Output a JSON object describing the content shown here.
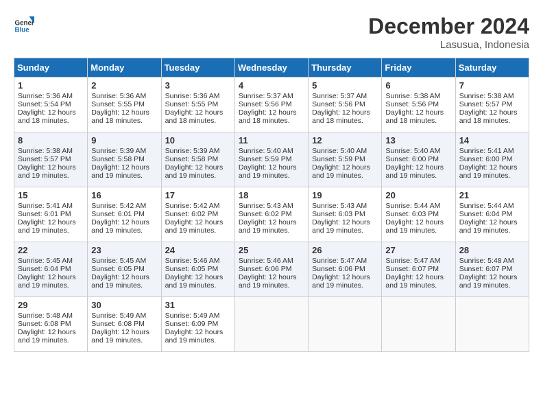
{
  "header": {
    "logo_general": "General",
    "logo_blue": "Blue",
    "month": "December 2024",
    "location": "Lasusua, Indonesia"
  },
  "days_of_week": [
    "Sunday",
    "Monday",
    "Tuesday",
    "Wednesday",
    "Thursday",
    "Friday",
    "Saturday"
  ],
  "weeks": [
    [
      {
        "day": 1,
        "sunrise": "5:36 AM",
        "sunset": "5:54 PM",
        "daylight": "12 hours and 18 minutes."
      },
      {
        "day": 2,
        "sunrise": "5:36 AM",
        "sunset": "5:55 PM",
        "daylight": "12 hours and 18 minutes."
      },
      {
        "day": 3,
        "sunrise": "5:36 AM",
        "sunset": "5:55 PM",
        "daylight": "12 hours and 18 minutes."
      },
      {
        "day": 4,
        "sunrise": "5:37 AM",
        "sunset": "5:56 PM",
        "daylight": "12 hours and 18 minutes."
      },
      {
        "day": 5,
        "sunrise": "5:37 AM",
        "sunset": "5:56 PM",
        "daylight": "12 hours and 18 minutes."
      },
      {
        "day": 6,
        "sunrise": "5:38 AM",
        "sunset": "5:56 PM",
        "daylight": "12 hours and 18 minutes."
      },
      {
        "day": 7,
        "sunrise": "5:38 AM",
        "sunset": "5:57 PM",
        "daylight": "12 hours and 18 minutes."
      }
    ],
    [
      {
        "day": 8,
        "sunrise": "5:38 AM",
        "sunset": "5:57 PM",
        "daylight": "12 hours and 19 minutes."
      },
      {
        "day": 9,
        "sunrise": "5:39 AM",
        "sunset": "5:58 PM",
        "daylight": "12 hours and 19 minutes."
      },
      {
        "day": 10,
        "sunrise": "5:39 AM",
        "sunset": "5:58 PM",
        "daylight": "12 hours and 19 minutes."
      },
      {
        "day": 11,
        "sunrise": "5:40 AM",
        "sunset": "5:59 PM",
        "daylight": "12 hours and 19 minutes."
      },
      {
        "day": 12,
        "sunrise": "5:40 AM",
        "sunset": "5:59 PM",
        "daylight": "12 hours and 19 minutes."
      },
      {
        "day": 13,
        "sunrise": "5:40 AM",
        "sunset": "6:00 PM",
        "daylight": "12 hours and 19 minutes."
      },
      {
        "day": 14,
        "sunrise": "5:41 AM",
        "sunset": "6:00 PM",
        "daylight": "12 hours and 19 minutes."
      }
    ],
    [
      {
        "day": 15,
        "sunrise": "5:41 AM",
        "sunset": "6:01 PM",
        "daylight": "12 hours and 19 minutes."
      },
      {
        "day": 16,
        "sunrise": "5:42 AM",
        "sunset": "6:01 PM",
        "daylight": "12 hours and 19 minutes."
      },
      {
        "day": 17,
        "sunrise": "5:42 AM",
        "sunset": "6:02 PM",
        "daylight": "12 hours and 19 minutes."
      },
      {
        "day": 18,
        "sunrise": "5:43 AM",
        "sunset": "6:02 PM",
        "daylight": "12 hours and 19 minutes."
      },
      {
        "day": 19,
        "sunrise": "5:43 AM",
        "sunset": "6:03 PM",
        "daylight": "12 hours and 19 minutes."
      },
      {
        "day": 20,
        "sunrise": "5:44 AM",
        "sunset": "6:03 PM",
        "daylight": "12 hours and 19 minutes."
      },
      {
        "day": 21,
        "sunrise": "5:44 AM",
        "sunset": "6:04 PM",
        "daylight": "12 hours and 19 minutes."
      }
    ],
    [
      {
        "day": 22,
        "sunrise": "5:45 AM",
        "sunset": "6:04 PM",
        "daylight": "12 hours and 19 minutes."
      },
      {
        "day": 23,
        "sunrise": "5:45 AM",
        "sunset": "6:05 PM",
        "daylight": "12 hours and 19 minutes."
      },
      {
        "day": 24,
        "sunrise": "5:46 AM",
        "sunset": "6:05 PM",
        "daylight": "12 hours and 19 minutes."
      },
      {
        "day": 25,
        "sunrise": "5:46 AM",
        "sunset": "6:06 PM",
        "daylight": "12 hours and 19 minutes."
      },
      {
        "day": 26,
        "sunrise": "5:47 AM",
        "sunset": "6:06 PM",
        "daylight": "12 hours and 19 minutes."
      },
      {
        "day": 27,
        "sunrise": "5:47 AM",
        "sunset": "6:07 PM",
        "daylight": "12 hours and 19 minutes."
      },
      {
        "day": 28,
        "sunrise": "5:48 AM",
        "sunset": "6:07 PM",
        "daylight": "12 hours and 19 minutes."
      }
    ],
    [
      {
        "day": 29,
        "sunrise": "5:48 AM",
        "sunset": "6:08 PM",
        "daylight": "12 hours and 19 minutes."
      },
      {
        "day": 30,
        "sunrise": "5:49 AM",
        "sunset": "6:08 PM",
        "daylight": "12 hours and 19 minutes."
      },
      {
        "day": 31,
        "sunrise": "5:49 AM",
        "sunset": "6:09 PM",
        "daylight": "12 hours and 19 minutes."
      },
      null,
      null,
      null,
      null
    ]
  ]
}
